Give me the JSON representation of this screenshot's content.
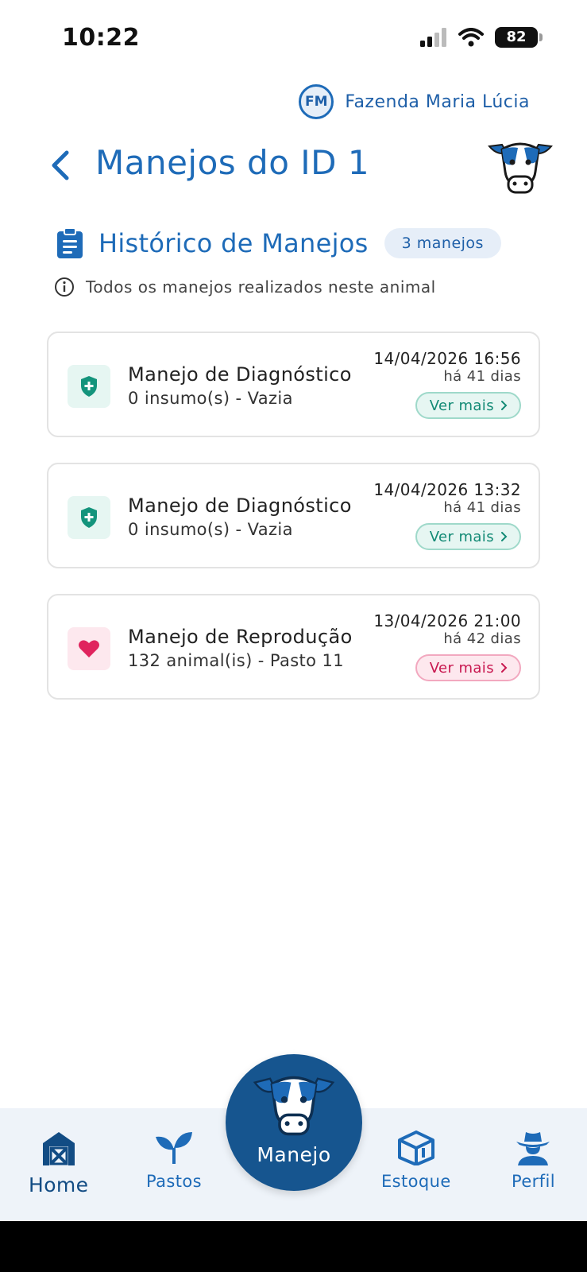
{
  "status_bar": {
    "time": "10:22",
    "battery": "82"
  },
  "farm": {
    "initials": "FM",
    "name": "Fazenda Maria Lúcia"
  },
  "header": {
    "title": "Manejos do ID 1"
  },
  "section": {
    "title": "Histórico de Manejos",
    "count": "3 manejos",
    "info": "Todos os manejos realizados neste animal"
  },
  "cards": [
    {
      "title": "Manejo de Diagnóstico",
      "subtitle": "0 insumo(s) - Vazia",
      "date": "14/04/2026 16:56",
      "ago": "há 41 dias",
      "button": "Ver mais",
      "icon": "shield-icon",
      "variant": "teal"
    },
    {
      "title": "Manejo de Diagnóstico",
      "subtitle": "0 insumo(s) - Vazia",
      "date": "14/04/2026 13:32",
      "ago": "há 41 dias",
      "button": "Ver mais",
      "icon": "shield-icon",
      "variant": "teal"
    },
    {
      "title": "Manejo de Reprodução",
      "subtitle": "132 animal(is) - Pasto 11",
      "date": "13/04/2026 21:00",
      "ago": "há 42 dias",
      "button": "Ver mais",
      "icon": "heart-icon",
      "variant": "pink"
    }
  ],
  "nav": {
    "home": "Home",
    "pastos": "Pastos",
    "manejo": "Manejo",
    "estoque": "Estoque",
    "perfil": "Perfil"
  },
  "colors": {
    "primary": "#1e6bb8",
    "nav_dark": "#16558f",
    "teal": "#128a75",
    "pink": "#e0245e"
  }
}
